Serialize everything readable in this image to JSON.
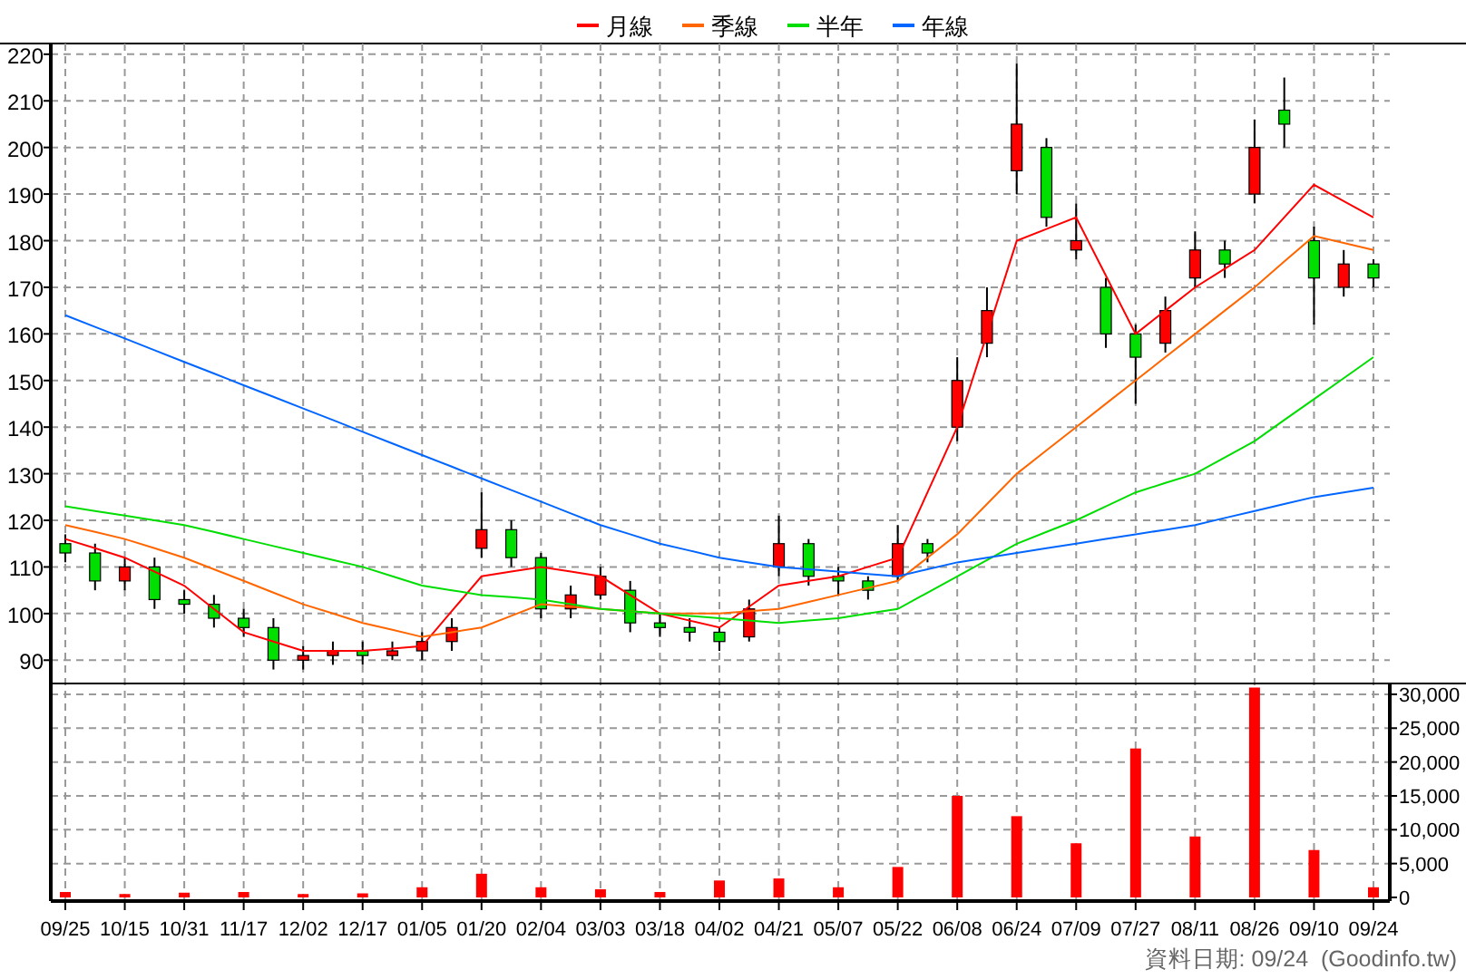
{
  "price_chart": {
    "chart_data": {
      "type": "candlestick",
      "categories": [
        null,
        null,
        null,
        null,
        null,
        null,
        null,
        null,
        null,
        null,
        null,
        null,
        null,
        null,
        null,
        null,
        null,
        null,
        null,
        null,
        null,
        null,
        null,
        null,
        null,
        null,
        null,
        null,
        null,
        null,
        null,
        null,
        null,
        null,
        null,
        null,
        null,
        null,
        null,
        null,
        null,
        null,
        null,
        null,
        null
      ],
      "ylim": [
        85,
        222.3
      ],
      "yticks": [
        90,
        100,
        110,
        120,
        130,
        140,
        150,
        160,
        170,
        180,
        190,
        200,
        210,
        220
      ],
      "ohlc": [
        [
          115,
          117,
          111,
          113
        ],
        [
          113,
          115,
          105,
          107
        ],
        [
          107,
          112,
          105,
          110
        ],
        [
          110,
          112,
          101,
          103
        ],
        [
          103,
          105,
          100,
          102
        ],
        [
          102,
          104,
          97,
          99
        ],
        [
          99,
          101,
          95,
          97
        ],
        [
          97,
          99,
          88,
          90
        ],
        [
          90,
          93,
          88,
          91
        ],
        [
          91,
          94,
          89,
          92
        ],
        [
          92,
          94,
          89,
          91
        ],
        [
          91,
          94,
          90,
          92
        ],
        [
          92,
          96,
          90,
          94
        ],
        [
          94,
          99,
          92,
          97
        ],
        [
          114,
          126,
          112,
          118
        ],
        [
          118,
          120,
          110,
          112
        ],
        [
          112,
          113,
          99,
          101
        ],
        [
          101,
          106,
          99,
          104
        ],
        [
          104,
          110,
          103,
          108
        ],
        [
          105,
          107,
          96,
          98
        ],
        [
          98,
          100,
          95,
          97
        ],
        [
          97,
          99,
          94,
          96
        ],
        [
          96,
          97,
          92,
          94
        ],
        [
          95,
          103,
          94,
          101
        ],
        [
          110,
          121,
          108,
          115
        ],
        [
          115,
          116,
          106,
          108
        ],
        [
          108,
          110,
          104,
          107
        ],
        [
          107,
          108,
          103,
          105
        ],
        [
          108,
          119,
          107,
          115
        ],
        [
          115,
          116,
          111,
          113
        ],
        [
          140,
          155,
          137,
          150
        ],
        [
          158,
          170,
          155,
          165
        ],
        [
          195,
          218,
          190,
          205
        ],
        [
          200,
          202,
          183,
          185
        ],
        [
          178,
          188,
          176,
          180
        ],
        [
          170,
          172,
          157,
          160
        ],
        [
          160,
          162,
          145,
          155
        ],
        [
          158,
          168,
          156,
          165
        ],
        [
          172,
          182,
          170,
          178
        ],
        [
          178,
          180,
          172,
          175
        ],
        [
          190,
          206,
          188,
          200
        ],
        [
          208,
          215,
          200,
          205
        ],
        [
          180,
          183,
          162,
          172
        ],
        [
          170,
          178,
          168,
          175
        ],
        [
          175,
          176,
          170,
          172
        ]
      ]
    },
    "moving_averages": {
      "chart_data": {
        "type": "line",
        "categories": [
          null,
          null,
          null,
          null,
          null,
          null,
          null,
          null,
          null,
          null,
          null,
          null,
          null,
          null,
          null,
          null,
          null,
          null,
          null,
          null,
          null,
          null,
          null,
          null,
          null,
          null,
          null,
          null,
          null,
          null,
          null,
          null,
          null,
          null,
          null,
          null,
          null,
          null,
          null,
          null,
          null,
          null,
          null,
          null,
          null
        ],
        "ylim": [
          85,
          222.3
        ],
        "series": [
          {
            "name": "月線",
            "color": "#ff0000",
            "values": [
              116,
              114,
              112,
              109,
              106,
              101,
              96,
              94,
              92,
              92,
              92,
              92.5,
              93,
              100.5,
              108,
              109,
              110,
              109,
              108,
              104,
              100,
              98.5,
              97,
              101.5,
              106,
              107,
              108,
              110,
              112,
              126,
              140,
              160,
              180,
              182.5,
              185,
              172.5,
              160,
              165,
              170,
              174,
              178,
              185,
              192,
              188.5,
              185
            ]
          },
          {
            "name": "季線",
            "color": "#ff6600",
            "values": [
              119,
              117.5,
              116,
              114,
              112,
              109.5,
              107,
              104.5,
              102,
              100,
              98,
              96.5,
              95,
              96,
              97,
              99.5,
              102,
              101.5,
              101,
              100.5,
              100,
              100,
              100,
              100.5,
              101,
              102.5,
              104,
              105.5,
              107,
              112,
              117,
              123.5,
              130,
              135,
              140,
              145,
              150,
              155,
              160,
              165,
              170,
              175.5,
              181,
              179.5,
              178
            ]
          },
          {
            "name": "半年",
            "color": "#00dd00",
            "values": [
              123,
              122,
              121,
              120,
              119,
              117.5,
              116,
              114.5,
              113,
              111.5,
              110,
              108,
              106,
              105,
              104,
              103.5,
              103,
              102,
              101,
              100.5,
              100,
              99.5,
              99,
              98.5,
              98,
              98.5,
              99,
              100,
              101,
              104.5,
              108,
              111.5,
              115,
              117.5,
              120,
              123,
              126,
              128,
              130,
              133.5,
              137,
              141.5,
              146,
              150.5,
              155
            ]
          },
          {
            "name": "年線",
            "color": "#0066ff",
            "values": [
              164,
              161.5,
              159,
              156.5,
              154,
              151.5,
              149,
              146.5,
              144,
              141.5,
              139,
              136.5,
              134,
              131.5,
              129,
              126.5,
              124,
              121.5,
              119,
              117,
              115,
              113.5,
              112,
              111,
              110,
              109.5,
              109,
              108.5,
              108,
              109.5,
              111,
              112,
              113,
              114,
              115,
              116,
              117,
              118,
              119,
              120.5,
              122,
              123.5,
              125,
              126,
              127
            ]
          }
        ]
      }
    }
  },
  "volume_chart": {
    "chart_data": {
      "type": "bar",
      "categories": [
        "09/25",
        "10/15",
        "10/31",
        "11/17",
        "12/02",
        "12/17",
        "01/05",
        "01/20",
        "02/04",
        "03/03",
        "03/18",
        "04/02",
        "04/21",
        "05/07",
        "05/22",
        "06/08",
        "06/24",
        "07/09",
        "07/27",
        "08/11",
        "08/26",
        "09/10",
        "09/24"
      ],
      "values": [
        800,
        500,
        700,
        800,
        500,
        600,
        1500,
        3500,
        1500,
        1200,
        800,
        2500,
        2800,
        1500,
        4500,
        15000,
        12000,
        8000,
        22000,
        9000,
        31000,
        7000,
        1500
      ],
      "ylim": [
        0,
        31600
      ],
      "yticks": [
        {
          "value": 0,
          "label": "0"
        },
        {
          "value": 5000,
          "label": "5,000"
        },
        {
          "value": 10000,
          "label": "10,000"
        },
        {
          "value": 15000,
          "label": "15,000"
        },
        {
          "value": 20000,
          "label": "20,000"
        },
        {
          "value": 25000,
          "label": "25,000"
        },
        {
          "value": 30000,
          "label": "30,000"
        }
      ]
    }
  },
  "footer": "資料日期: 09/24  (Goodinfo.tw)"
}
